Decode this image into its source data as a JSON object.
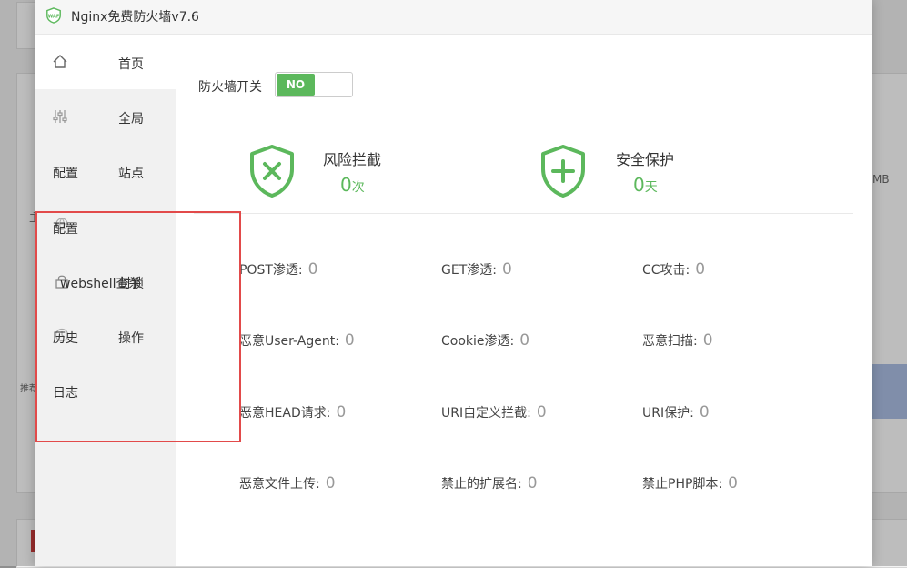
{
  "window": {
    "title": "Nginx免费防火墙v7.6"
  },
  "background": {
    "left_label": "主",
    "side_label": "推荐",
    "size_label": "MB"
  },
  "sidebar": {
    "items": [
      {
        "label": "首页"
      },
      {
        "label": "全局"
      },
      {
        "label": "配置"
      },
      {
        "label": "站点"
      },
      {
        "label": "配置"
      },
      {
        "label": "webshell查杀"
      },
      {
        "label": "封锁"
      },
      {
        "label": "历史"
      },
      {
        "label": "操作"
      },
      {
        "label": "日志"
      }
    ]
  },
  "main": {
    "switch_label": "防火墙开关",
    "switch_state": "NO",
    "accent_color": "#5cb85c",
    "stats": [
      {
        "title": "风险拦截",
        "value": "0",
        "unit": "次",
        "icon": "shield-x-icon"
      },
      {
        "title": "安全保护",
        "value": "0",
        "unit": "天",
        "icon": "shield-plus-icon"
      }
    ],
    "metrics": [
      {
        "label": "POST渗透:",
        "value": "0"
      },
      {
        "label": "GET渗透:",
        "value": "0"
      },
      {
        "label": "CC攻击:",
        "value": "0"
      },
      {
        "label": "恶意User-Agent:",
        "value": "0"
      },
      {
        "label": "Cookie渗透:",
        "value": "0"
      },
      {
        "label": "恶意扫描:",
        "value": "0"
      },
      {
        "label": "恶意HEAD请求:",
        "value": "0"
      },
      {
        "label": "URI自定义拦截:",
        "value": "0"
      },
      {
        "label": "URI保护:",
        "value": "0"
      },
      {
        "label": "恶意文件上传:",
        "value": "0"
      },
      {
        "label": "禁止的扩展名:",
        "value": "0"
      },
      {
        "label": "禁止PHP脚本:",
        "value": "0"
      }
    ]
  }
}
